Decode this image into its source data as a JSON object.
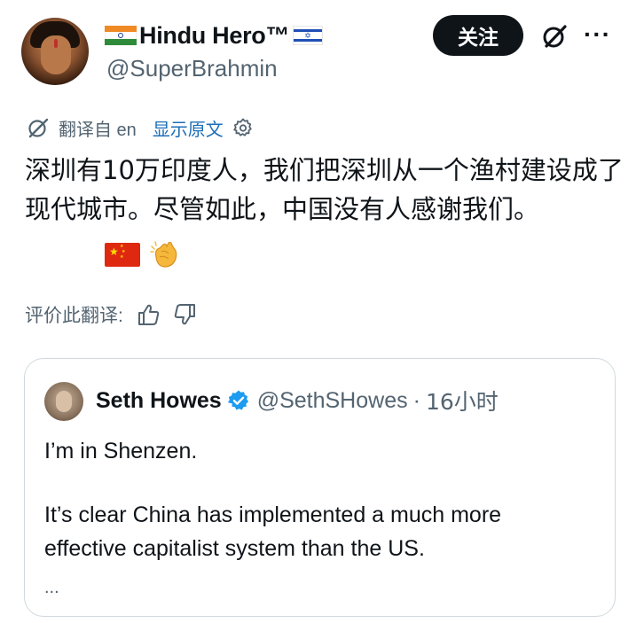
{
  "author": {
    "display_name": "Hindu Hero™",
    "handle": "@SuperBrahmin",
    "avatar_icon": "profile-avatar",
    "left_flag_icon": "india-flag-icon",
    "right_flag_icon": "israel-flag-icon"
  },
  "actions": {
    "follow_label": "关注",
    "grok_icon": "grok-icon",
    "more_label": "···"
  },
  "translation": {
    "translated_from": "翻译自 en",
    "show_original": "显示原文",
    "rate_label": "评价此翻译:"
  },
  "tweet": {
    "text": "深圳有10万印度人，我们把深圳从一个渔村建设成了现代城市。尽管如此，中国没有人感谢我们。",
    "emojis": [
      "china-flag-icon",
      "clapping-hands-icon"
    ]
  },
  "quote": {
    "display_name": "Seth Howes",
    "handle": "@SethSHowes",
    "separator": "·",
    "time": "16小时",
    "line1": "I’m in Shenzen.",
    "line2": "It’s clear China has implemented a much more",
    "line3": "effective capitalist system than the US.",
    "ellipsis": "..."
  },
  "colors": {
    "text": "#0f1419",
    "secondary": "#536471",
    "link": "#1d6fb8",
    "verified": "#1d9bf0",
    "border": "#cfd9de"
  }
}
